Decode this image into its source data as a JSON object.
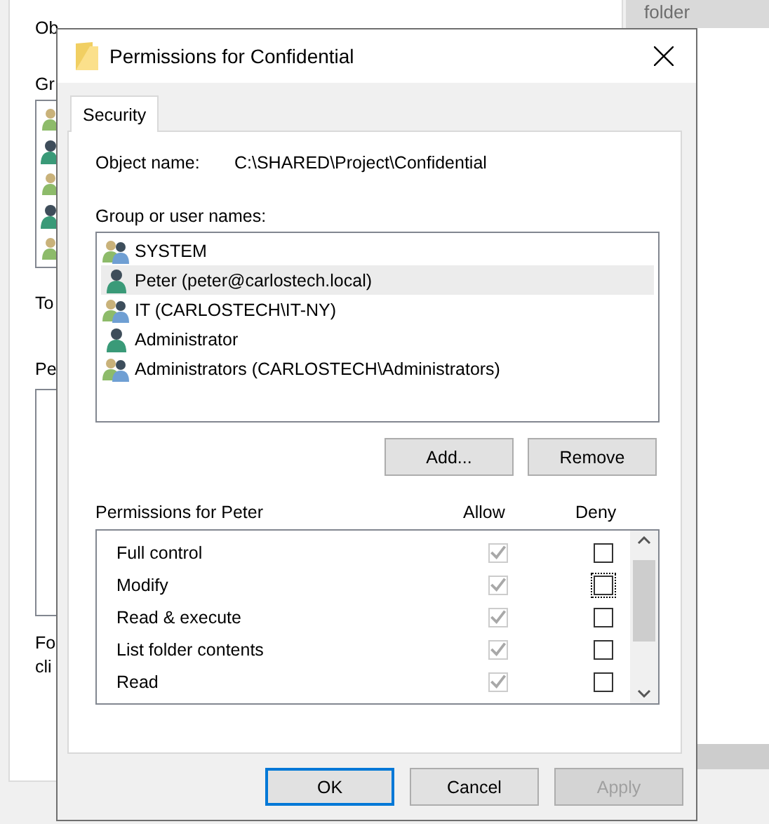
{
  "background_window": {
    "labels": [
      "Ob",
      "Gr",
      "To",
      "Pe",
      "Fo",
      "cli"
    ],
    "list_icons": [
      {
        "kind": "group"
      },
      {
        "kind": "user"
      },
      {
        "kind": "group"
      },
      {
        "kind": "user"
      },
      {
        "kind": "group"
      }
    ]
  },
  "side_window": {
    "item": "folder"
  },
  "dialog": {
    "title": "Permissions for Confidential",
    "tabs": [
      {
        "label": "Security",
        "selected": true
      }
    ],
    "object_label": "Object name:",
    "object_value": "C:\\SHARED\\Project\\Confidential",
    "users_label": "Group or user names:",
    "users": [
      {
        "name": "SYSTEM",
        "kind": "group",
        "selected": false
      },
      {
        "name": "Peter (peter@carlostech.local)",
        "kind": "user",
        "selected": true
      },
      {
        "name": "IT (CARLOSTECH\\IT-NY)",
        "kind": "group",
        "selected": false
      },
      {
        "name": "Administrator",
        "kind": "user",
        "selected": false
      },
      {
        "name": "Administrators (CARLOSTECH\\Administrators)",
        "kind": "group",
        "selected": false
      }
    ],
    "user_buttons": [
      "Add...",
      "Remove"
    ],
    "permissions_label": "Permissions for Peter",
    "allow_heading": "Allow",
    "deny_heading": "Deny",
    "permissions": [
      {
        "name": "Full control",
        "allow": true,
        "allow_disabled": true,
        "deny": false,
        "focused": false
      },
      {
        "name": "Modify",
        "allow": true,
        "allow_disabled": true,
        "deny": false,
        "focused": true
      },
      {
        "name": "Read & execute",
        "allow": true,
        "allow_disabled": true,
        "deny": false,
        "focused": false
      },
      {
        "name": "List folder contents",
        "allow": true,
        "allow_disabled": true,
        "deny": false,
        "focused": false
      },
      {
        "name": "Read",
        "allow": true,
        "allow_disabled": true,
        "deny": false,
        "focused": false
      }
    ],
    "buttons": [
      {
        "label": "OK",
        "default": true,
        "disabled": false
      },
      {
        "label": "Cancel",
        "default": false,
        "disabled": false
      },
      {
        "label": "Apply",
        "default": false,
        "disabled": true
      }
    ]
  }
}
